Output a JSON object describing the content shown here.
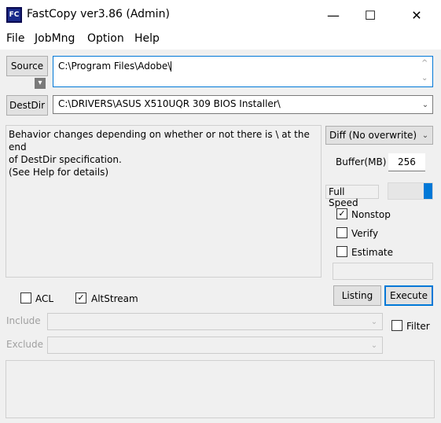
{
  "window": {
    "icon_text": "FC",
    "title": "FastCopy ver3.86 (Admin)",
    "minimize_glyph": "—",
    "maximize_glyph": "☐",
    "close_glyph": "✕"
  },
  "menu": [
    "File",
    "JobMng",
    "Option",
    "Help"
  ],
  "source": {
    "button_label": "Source",
    "value": "C:\\Program Files\\Adobe\\"
  },
  "destdir": {
    "button_label": "DestDir",
    "value": "C:\\DRIVERS\\ASUS X510UQR 309 BIOS Installer\\"
  },
  "info": {
    "line1": "Behavior changes depending on whether or not there is \\ at the end",
    "line2": "of DestDir specification.",
    "line3": "(See Help for details)"
  },
  "mode": {
    "selected": "Diff (No overwrite)"
  },
  "buffer": {
    "label": "Buffer(MB)",
    "value": "256"
  },
  "speed": {
    "label": "Full Speed",
    "level": 1.0
  },
  "options": {
    "nonstop": {
      "label": "Nonstop",
      "checked": true
    },
    "verify": {
      "label": "Verify",
      "checked": false
    },
    "estimate": {
      "label": "Estimate",
      "checked": false
    }
  },
  "acl": {
    "label": "ACL",
    "checked": false
  },
  "altstream": {
    "label": "AltStream",
    "checked": true
  },
  "actions": {
    "listing": "Listing",
    "execute": "Execute"
  },
  "filters": {
    "include_label": "Include",
    "exclude_label": "Exclude",
    "filter_label": "Filter",
    "filter_checked": false
  },
  "colors": {
    "accent": "#0078d7",
    "title_bg": "#ffffff",
    "panel_bg": "#f0f0f0"
  },
  "icons": {
    "check": "✓",
    "chevron": "⌄",
    "scroll_up": "^",
    "scroll_down": "⌄",
    "dropdown": "▾"
  }
}
